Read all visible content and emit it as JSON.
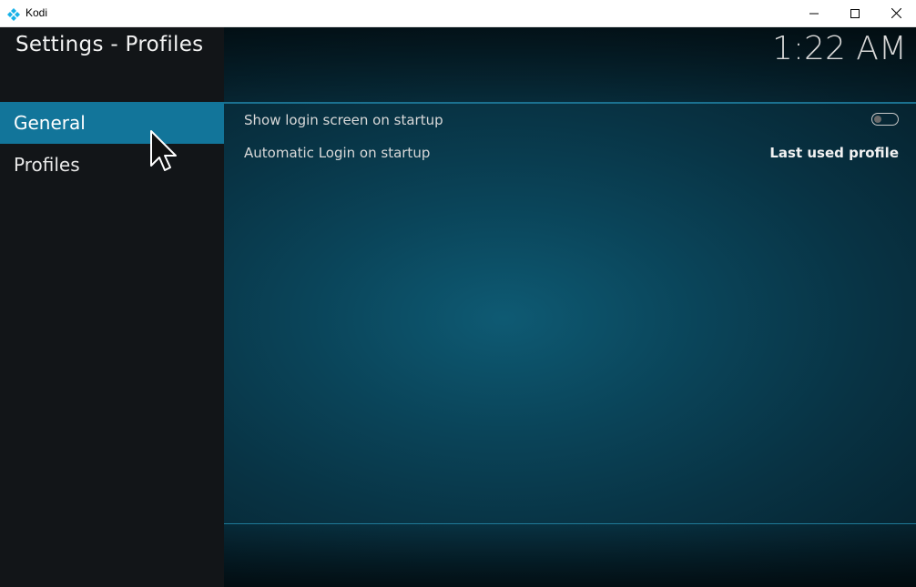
{
  "window": {
    "title": "Kodi",
    "icon": "kodi-logo-icon",
    "controls": [
      "minimize-icon",
      "maximize-icon",
      "close-icon"
    ]
  },
  "header": {
    "title": "Settings - Profiles",
    "clock": "1:22 AM"
  },
  "sidebar": {
    "items": [
      {
        "label": "General",
        "active": true
      },
      {
        "label": "Profiles",
        "active": false
      }
    ]
  },
  "settings": [
    {
      "label": "Show login screen on startup",
      "type": "toggle",
      "value": false
    },
    {
      "label": "Automatic Login on startup",
      "type": "select",
      "value": "Last used profile"
    }
  ],
  "colors": {
    "accent": "#12759a",
    "sidebar_bg": "#121518",
    "content_bg": "#083344"
  }
}
